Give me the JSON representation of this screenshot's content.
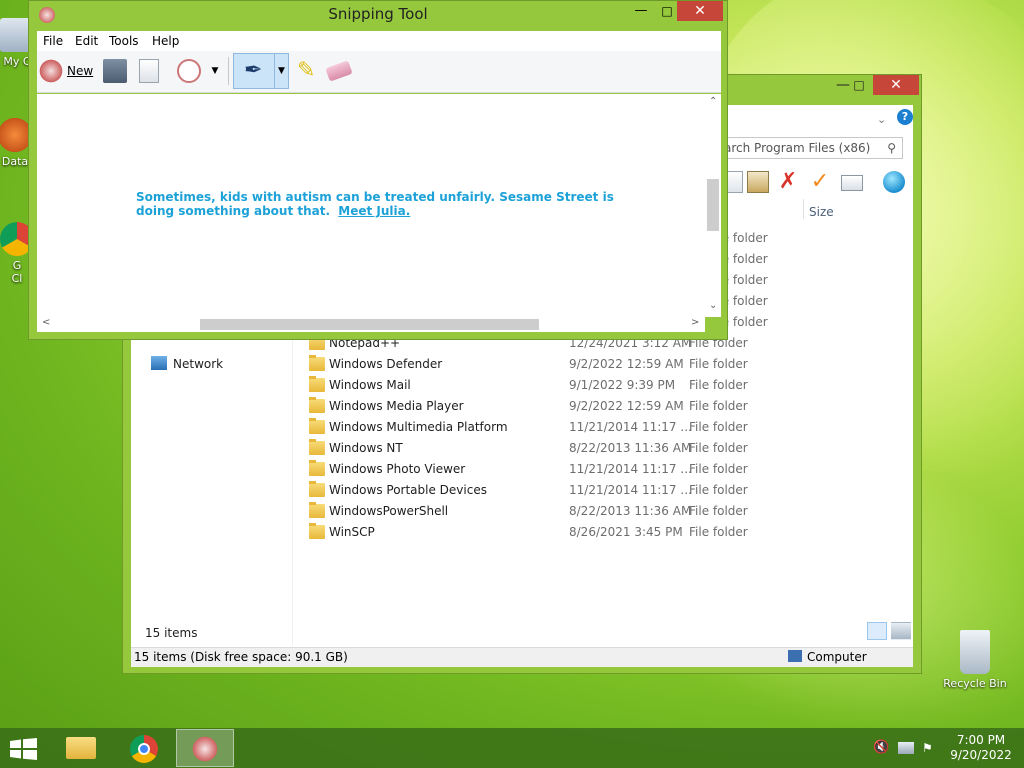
{
  "snipping_tool": {
    "title": "Snipping Tool",
    "menu": [
      "File",
      "Edit",
      "Tools",
      "Help"
    ],
    "new_label": "New",
    "canvas_text": "Sometimes, kids with autism can be treated unfairly. Sesame Street is doing something about that.",
    "canvas_link": "Meet Julia."
  },
  "explorer": {
    "search_placeholder": "Search Program Files (x86)",
    "size_column": "Size",
    "nav_network": "Network",
    "partial_row": {
      "name": "Notepad++",
      "date": "12/24/2021 3:12 AM",
      "type": "File folder"
    },
    "files": [
      {
        "name": "Windows Defender",
        "date": "9/2/2022 12:59 AM",
        "type": "File folder"
      },
      {
        "name": "Windows Mail",
        "date": "9/1/2022 9:39 PM",
        "type": "File folder"
      },
      {
        "name": "Windows Media Player",
        "date": "9/2/2022 12:59 AM",
        "type": "File folder"
      },
      {
        "name": "Windows Multimedia Platform",
        "date": "11/21/2014 11:17 ...",
        "type": "File folder"
      },
      {
        "name": "Windows NT",
        "date": "8/22/2013 11:36 AM",
        "type": "File folder"
      },
      {
        "name": "Windows Photo Viewer",
        "date": "11/21/2014 11:17 ...",
        "type": "File folder"
      },
      {
        "name": "Windows Portable Devices",
        "date": "11/21/2014 11:17 ...",
        "type": "File folder"
      },
      {
        "name": "WindowsPowerShell",
        "date": "8/22/2013 11:36 AM",
        "type": "File folder"
      },
      {
        "name": "WinSCP",
        "date": "8/26/2021 3:45 PM",
        "type": "File folder"
      }
    ],
    "hidden_rows_type": [
      "older",
      "older",
      "older",
      "older",
      "older"
    ],
    "hidden_type_label": "File folder",
    "items_count": "15 items",
    "status_left": "15 items (Disk free space: 90.1 GB)",
    "status_right": "Computer"
  },
  "desktop": {
    "icons": [
      {
        "label": "My C",
        "icon": "computer-icon"
      },
      {
        "label": "Data",
        "icon": "data-shortcut-icon"
      },
      {
        "label": "G\nCl",
        "icon": "chrome-shortcut-icon"
      }
    ],
    "recycle_bin": "Recycle Bin"
  },
  "taskbar": {
    "time": "7:00 PM",
    "date": "9/20/2022"
  }
}
